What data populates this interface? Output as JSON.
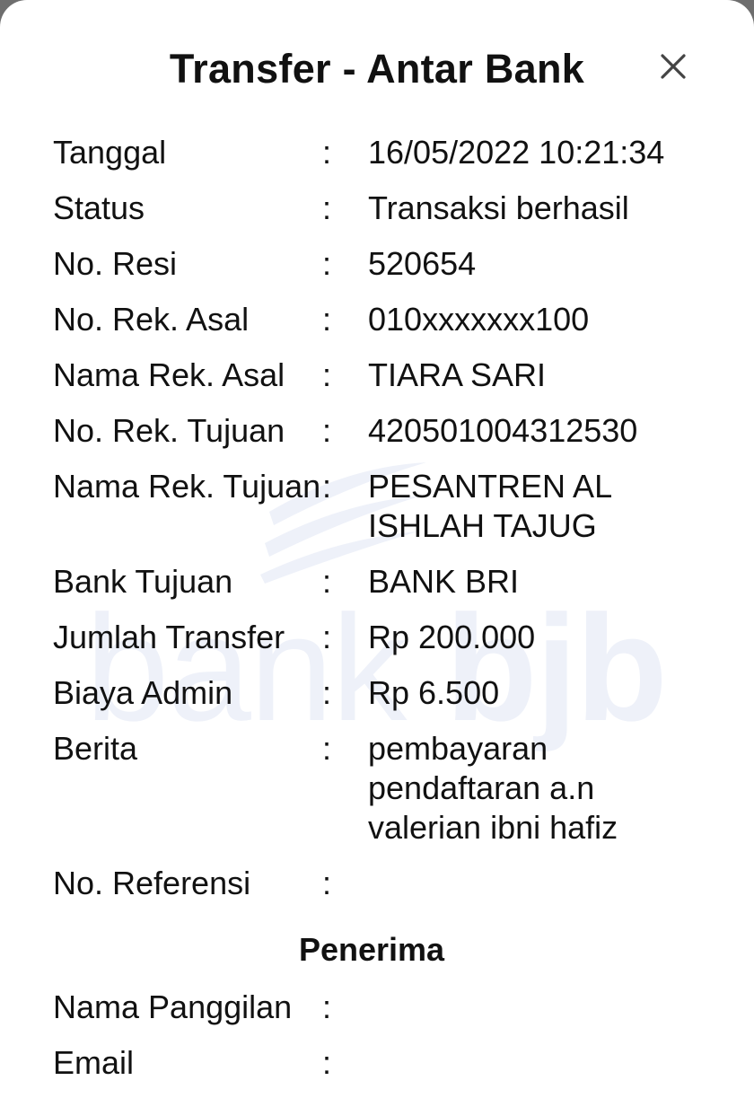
{
  "header": {
    "title": "Transfer - Antar Bank",
    "close_icon": "close-icon"
  },
  "watermark": {
    "text_light": "bank",
    "text_bold": "bjb"
  },
  "details": [
    {
      "label": "Tanggal",
      "sep": ":",
      "value": "16/05/2022 10:21:34"
    },
    {
      "label": "Status",
      "sep": ":",
      "value": "Transaksi berhasil"
    },
    {
      "label": "No. Resi",
      "sep": ":",
      "value": "520654"
    },
    {
      "label": "No. Rek. Asal",
      "sep": ":",
      "value": "010xxxxxxx100"
    },
    {
      "label": "Nama Rek. Asal",
      "sep": ":",
      "value": "TIARA SARI"
    },
    {
      "label": "No. Rek. Tujuan",
      "sep": ":",
      "value": "420501004312530"
    },
    {
      "label": "Nama Rek. Tujuan",
      "sep": ":",
      "value": "PESANTREN AL ISHLAH TAJUG"
    },
    {
      "label": "Bank Tujuan",
      "sep": ":",
      "value": "BANK BRI"
    },
    {
      "label": "Jumlah Transfer",
      "sep": ":",
      "value": "Rp 200.000"
    },
    {
      "label": "Biaya Admin",
      "sep": ":",
      "value": "Rp 6.500"
    },
    {
      "label": "Berita",
      "sep": ":",
      "value": "pembayaran pendaftaran a.n valerian ibni hafiz"
    },
    {
      "label": "No. Referensi",
      "sep": ":",
      "value": ""
    }
  ],
  "recipient": {
    "title": "Penerima",
    "rows": [
      {
        "label": "Nama Panggilan",
        "sep": ":",
        "value": ""
      },
      {
        "label": "Email",
        "sep": ":",
        "value": ""
      }
    ]
  },
  "colors": {
    "background": "#ffffff",
    "text": "#111111",
    "watermark": "#eef1f9",
    "overlay": "#6e6e6e"
  }
}
